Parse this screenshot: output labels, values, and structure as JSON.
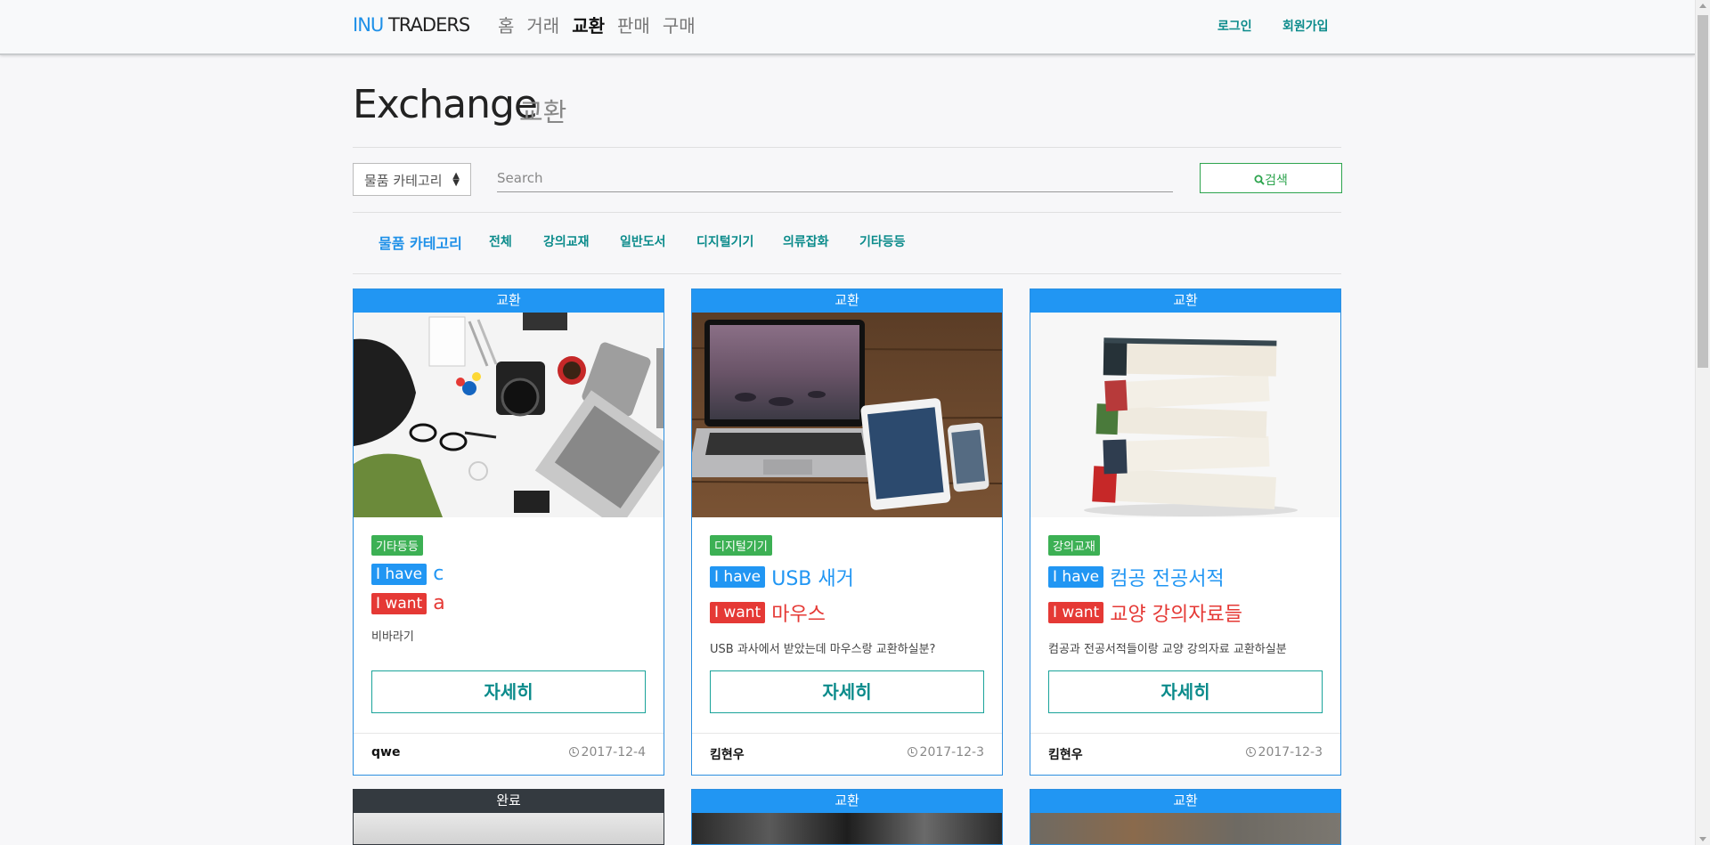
{
  "navbar": {
    "brand_inu": "INU",
    "brand_traders": "TRADERS",
    "links": [
      "홈",
      "거래",
      "교환",
      "판매",
      "구매"
    ],
    "active_index": 2,
    "login": "로그인",
    "signup": "회원가입"
  },
  "page": {
    "title": "Exchange",
    "subtitle": "교환"
  },
  "search": {
    "category_select": "물품 카테고리",
    "placeholder": "Search",
    "button_label": "검색"
  },
  "categories": {
    "heading": "물품 카테고리",
    "items": [
      "전체",
      "강의교재",
      "일반도서",
      "디지털기기",
      "의류잡화",
      "기타등등"
    ]
  },
  "cards": [
    {
      "status": "교환",
      "category": "기타등등",
      "have_label": "I have",
      "have": "c",
      "want_label": "I want",
      "want": "a",
      "description": "비바라기",
      "detail_label": "자세히",
      "author": "qwe",
      "date": "2017-12-4"
    },
    {
      "status": "교환",
      "category": "디지털기기",
      "have_label": "I have",
      "have": "USB 새거",
      "want_label": "I want",
      "want": "마우스",
      "description": "USB 과사에서 받았는데 마우스랑 교환하실분?",
      "detail_label": "자세히",
      "author": "킴현우",
      "date": "2017-12-3"
    },
    {
      "status": "교환",
      "category": "강의교재",
      "have_label": "I have",
      "have": "컴공 전공서적",
      "want_label": "I want",
      "want": "교양 강의자료들",
      "description": "컴공과 전공서적들이랑 교양 강의자료 교환하실분",
      "detail_label": "자세히",
      "author": "킴현우",
      "date": "2017-12-3"
    }
  ],
  "second_row_banners": [
    "완료",
    "교환",
    "교환"
  ],
  "colors": {
    "accent_blue": "#2196f3",
    "want_red": "#e53935",
    "category_green": "#3cb054",
    "teal": "#0b8b8b",
    "done_dark": "#343a40"
  }
}
